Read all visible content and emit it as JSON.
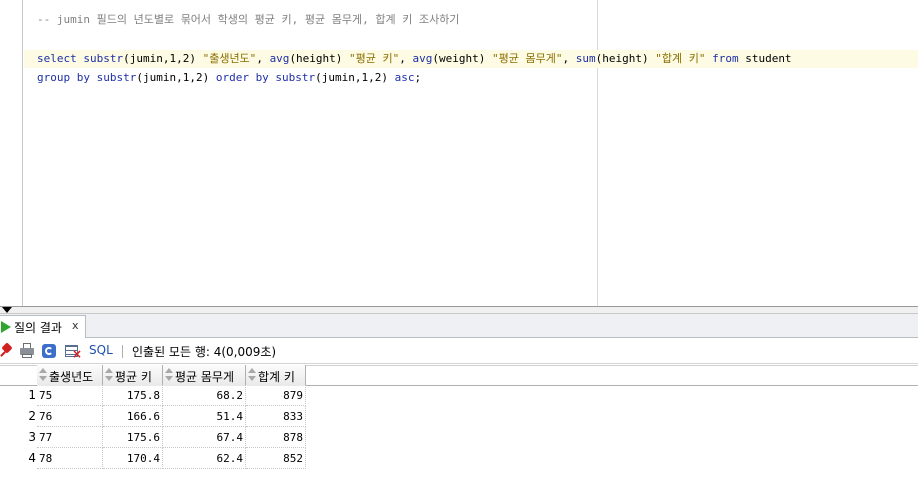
{
  "editor": {
    "comment": "-- jumin 필드의 년도별로 묶어서 학생의 평균 키, 평균 몸무게, 합계 키 조사하기",
    "line2": {
      "t1": "select substr",
      "t2": "(jumin,1,2) ",
      "t3": "\"출생년도\"",
      "t4": ", ",
      "t5": "avg",
      "t6": "(height) ",
      "t7": "\"평균 키\"",
      "t8": ", ",
      "t9": "avg",
      "t10": "(weight) ",
      "t11": "\"평균 몸무게\"",
      "t12": ", ",
      "t13": "sum",
      "t14": "(height) ",
      "t15": "\"합계 키\"",
      "t16": " from",
      "t17": " student"
    },
    "line3": {
      "t1": "group by substr",
      "t2": "(jumin,1,2) ",
      "t3": "order by substr",
      "t4": "(jumin,1,2) ",
      "t5": "asc",
      "t6": ";"
    }
  },
  "results": {
    "tab_label": "질의 결과",
    "tab_close": "x",
    "sql_label": "SQL",
    "status": "인출된 모든 행: 4(0,009초)",
    "columns": [
      "출생년도",
      "평균 키",
      "평균 몸무게",
      "합계 키"
    ],
    "rows": [
      {
        "num": "1",
        "c1": "75",
        "c2": "175.8",
        "c3": "68.2",
        "c4": "879"
      },
      {
        "num": "2",
        "c1": "76",
        "c2": "166.6",
        "c3": "51.4",
        "c4": "833"
      },
      {
        "num": "3",
        "c1": "77",
        "c2": "175.6",
        "c3": "67.4",
        "c4": "878"
      },
      {
        "num": "4",
        "c1": "78",
        "c2": "170.4",
        "c3": "62.4",
        "c4": "852"
      }
    ]
  },
  "icons": [
    "pin-icon",
    "print-icon",
    "refresh-icon",
    "clear-icon",
    "run-icon",
    "sort-icon"
  ],
  "colors": {
    "keyword": "#1e2fa8",
    "string": "#8a6d00",
    "comment": "#808080",
    "run": "#2fa52f"
  }
}
